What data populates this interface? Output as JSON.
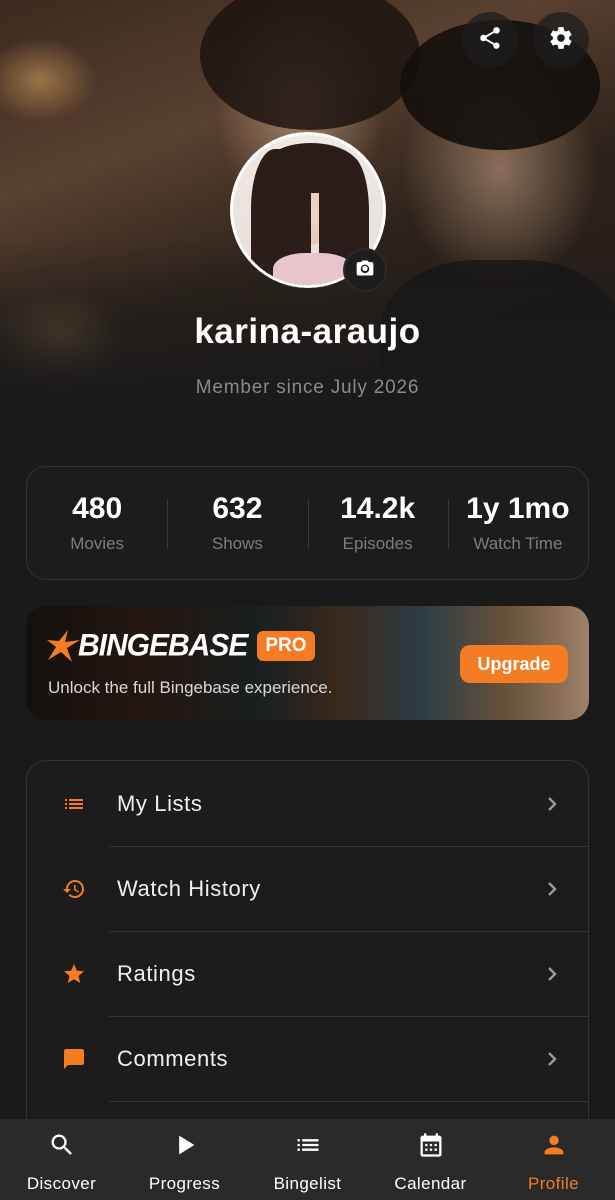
{
  "header": {
    "share_icon": "share-icon",
    "settings_icon": "gear-icon"
  },
  "profile": {
    "username": "karina-araujo",
    "member_since": "Member since July 2026",
    "camera_icon": "camera-icon"
  },
  "stats": [
    {
      "value": "480",
      "label": "Movies"
    },
    {
      "value": "632",
      "label": "Shows"
    },
    {
      "value": "14.2k",
      "label": "Episodes"
    },
    {
      "value": "1y 1mo",
      "label": "Watch Time"
    }
  ],
  "pro_banner": {
    "logo_text": "BINGEBASE",
    "badge": "PRO",
    "tagline": "Unlock the full Bingebase experience.",
    "cta": "Upgrade"
  },
  "menu": [
    {
      "label": "My Lists",
      "icon": "list-icon"
    },
    {
      "label": "Watch History",
      "icon": "history-icon"
    },
    {
      "label": "Ratings",
      "icon": "star-icon"
    },
    {
      "label": "Comments",
      "icon": "comment-icon"
    }
  ],
  "bottom_nav": [
    {
      "label": "Discover",
      "icon": "search-icon",
      "active": false
    },
    {
      "label": "Progress",
      "icon": "play-icon",
      "active": false
    },
    {
      "label": "Bingelist",
      "icon": "list-icon",
      "active": false
    },
    {
      "label": "Calendar",
      "icon": "calendar-icon",
      "active": false
    },
    {
      "label": "Profile",
      "icon": "person-icon",
      "active": true
    }
  ],
  "colors": {
    "accent": "#f57c22",
    "background": "#1a1a1b",
    "card": "#1c1c1d",
    "nav_bar": "#2a2a2a"
  }
}
